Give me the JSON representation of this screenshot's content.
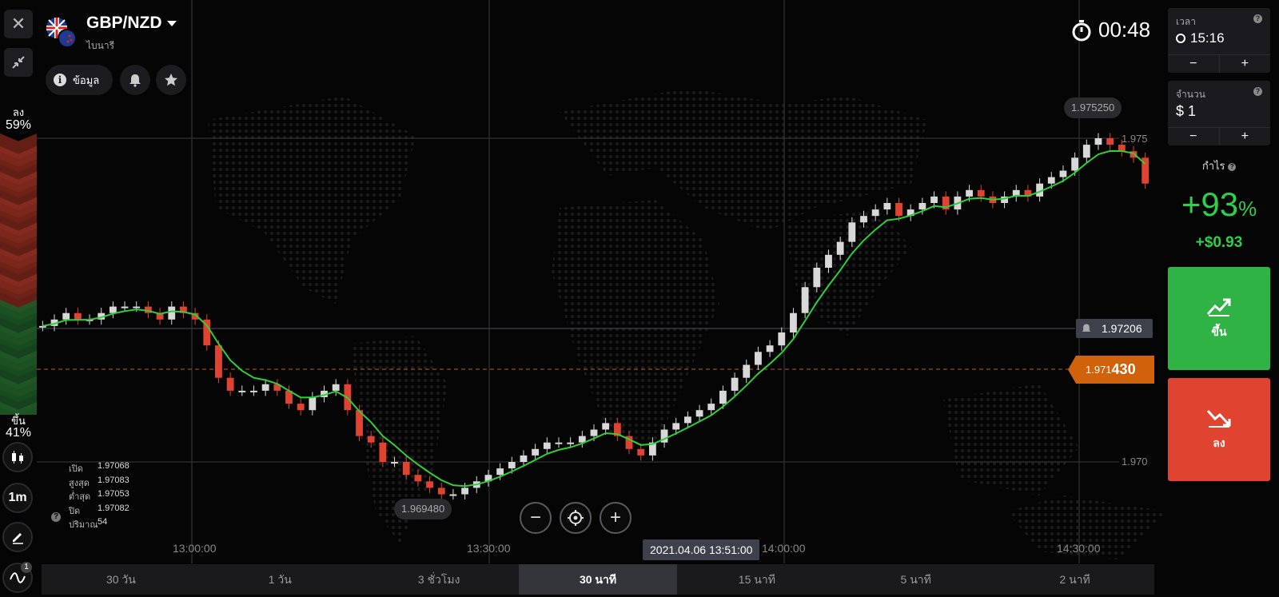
{
  "asset": {
    "pair": "GBP/NZD",
    "type": "ไบนารี"
  },
  "header": {
    "info_label": "ข้อมูล",
    "timer": "00:48"
  },
  "sentiment": {
    "down_label": "ลง",
    "down_pct": "59%",
    "up_label": "ขึ้น",
    "up_pct": "41%"
  },
  "tools": {
    "timeframe": "1m",
    "indicator_badge": "1"
  },
  "ohlc": {
    "open_label": "เปิด",
    "open": "1.97068",
    "high_label": "สูงสุด",
    "high": "1.97083",
    "low_label": "ต่ำสุด",
    "low": "1.97053",
    "close_label": "ปิด",
    "close": "1.97082",
    "volume_label": "ปริมาณ",
    "volume": "54"
  },
  "right_panel": {
    "time_label": "เวลา",
    "time_value": "15:16",
    "amount_label": "จำนวน",
    "amount_value": "$ 1",
    "minus": "−",
    "plus": "+",
    "profit_label": "กำไร",
    "profit_pct": "+93",
    "profit_pct_sign": "%",
    "profit_amount": "+$0.93",
    "up_button": "ขึ้น",
    "down_button": "ลง",
    "up_color": "#2fb344",
    "down_color": "#e0432f"
  },
  "chart": {
    "high_marker": "1.975250",
    "low_marker": "1.969480",
    "alert_price": "1.97206",
    "current_price_prefix": "1.971",
    "current_price_suffix": "430",
    "price_label_top": "1.975",
    "price_label_bottom": "1.970",
    "time_labels": [
      "13:00:00",
      "13:30:00",
      "14:00:00",
      "14:30:00"
    ],
    "crosshair_time": "2021.04.06 13:51:00"
  },
  "tabs": [
    {
      "label": "30 วัน"
    },
    {
      "label": "1 วัน"
    },
    {
      "label": "3 ชั่วโมง"
    },
    {
      "label": "30 นาที"
    },
    {
      "label": "15 นาที"
    },
    {
      "label": "5 นาที"
    },
    {
      "label": "2 นาที"
    }
  ],
  "chart_data": {
    "type": "line",
    "title": "",
    "x": [
      "13:00:00",
      "13:30:00",
      "14:00:00",
      "14:30:00"
    ],
    "ylim": [
      1.969,
      1.9755
    ],
    "y_ticks": [
      1.97,
      1.975
    ],
    "annotations": {
      "high": 1.97525,
      "low": 1.96948,
      "alert": 1.97206,
      "current": 1.97143
    },
    "candles_close": [
      1.9721,
      1.9722,
      1.9723,
      1.9722,
      1.9722,
      1.9723,
      1.9724,
      1.9724,
      1.9724,
      1.9723,
      1.9722,
      1.9724,
      1.9723,
      1.9722,
      1.9718,
      1.9713,
      1.9711,
      1.9711,
      1.9711,
      1.9712,
      1.9711,
      1.9709,
      1.9708,
      1.971,
      1.9711,
      1.9712,
      1.9708,
      1.9704,
      1.9703,
      1.97,
      1.97,
      1.9698,
      1.9697,
      1.9696,
      1.9695,
      1.9695,
      1.9696,
      1.9697,
      1.9698,
      1.9699,
      1.97,
      1.9701,
      1.9702,
      1.9703,
      1.9703,
      1.9703,
      1.9704,
      1.9705,
      1.9706,
      1.9704,
      1.9702,
      1.9701,
      1.9703,
      1.9705,
      1.9706,
      1.9707,
      1.9708,
      1.9709,
      1.9711,
      1.9713,
      1.9715,
      1.9717,
      1.9718,
      1.972,
      1.9723,
      1.9727,
      1.973,
      1.9732,
      1.9734,
      1.9737,
      1.9738,
      1.9739,
      1.974,
      1.9738,
      1.9739,
      1.974,
      1.9741,
      1.9739,
      1.9741,
      1.9742,
      1.9741,
      1.974,
      1.9741,
      1.9742,
      1.9741,
      1.9743,
      1.9744,
      1.9745,
      1.9747,
      1.9749,
      1.975,
      1.9749,
      1.9748,
      1.9747,
      1.9743
    ],
    "moving_average": "green"
  }
}
